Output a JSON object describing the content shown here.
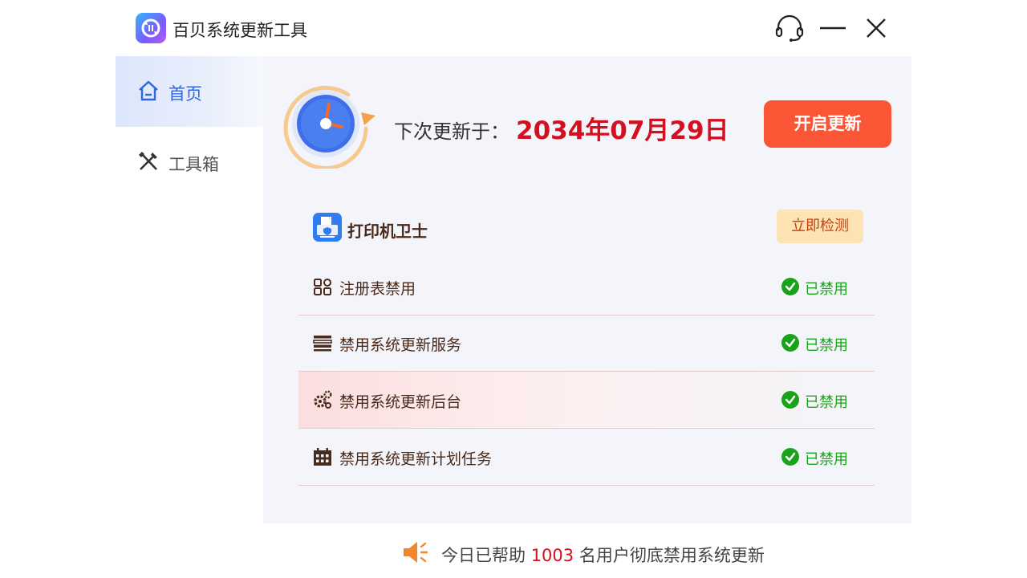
{
  "window": {
    "title": "百贝系统更新工具",
    "controls": [
      "support-icon",
      "minimize-icon",
      "close-icon"
    ]
  },
  "sidebar": {
    "items": [
      {
        "label": "首页",
        "icon": "home-icon",
        "active": true
      },
      {
        "label": "工具箱",
        "icon": "tools-icon",
        "active": false
      }
    ]
  },
  "main": {
    "next_update_label": "下次更新于：",
    "next_update_date": "2034年07月29日",
    "start_button": "开启更新",
    "printer": {
      "label": "打印机卫士",
      "button": "立即检测"
    },
    "rows": [
      {
        "icon": "grid-icon",
        "label": "注册表禁用",
        "status": "已禁用"
      },
      {
        "icon": "list-icon",
        "label": "禁用系统更新服务",
        "status": "已禁用"
      },
      {
        "icon": "gears-icon",
        "label": "禁用系统更新后台",
        "status": "已禁用"
      },
      {
        "icon": "calendar-icon",
        "label": "禁用系统更新计划任务",
        "status": "已禁用"
      }
    ]
  },
  "footer": {
    "prefix": "今日已帮助 ",
    "count": "1003",
    "suffix": " 名用户彻底禁用系统更新"
  },
  "colors": {
    "accent_blue": "#2e64e6",
    "date_red": "#d40f1f",
    "start_button": "#fa5535",
    "status_green": "#1aa31a",
    "detect_button_bg": "#fde2b4"
  }
}
